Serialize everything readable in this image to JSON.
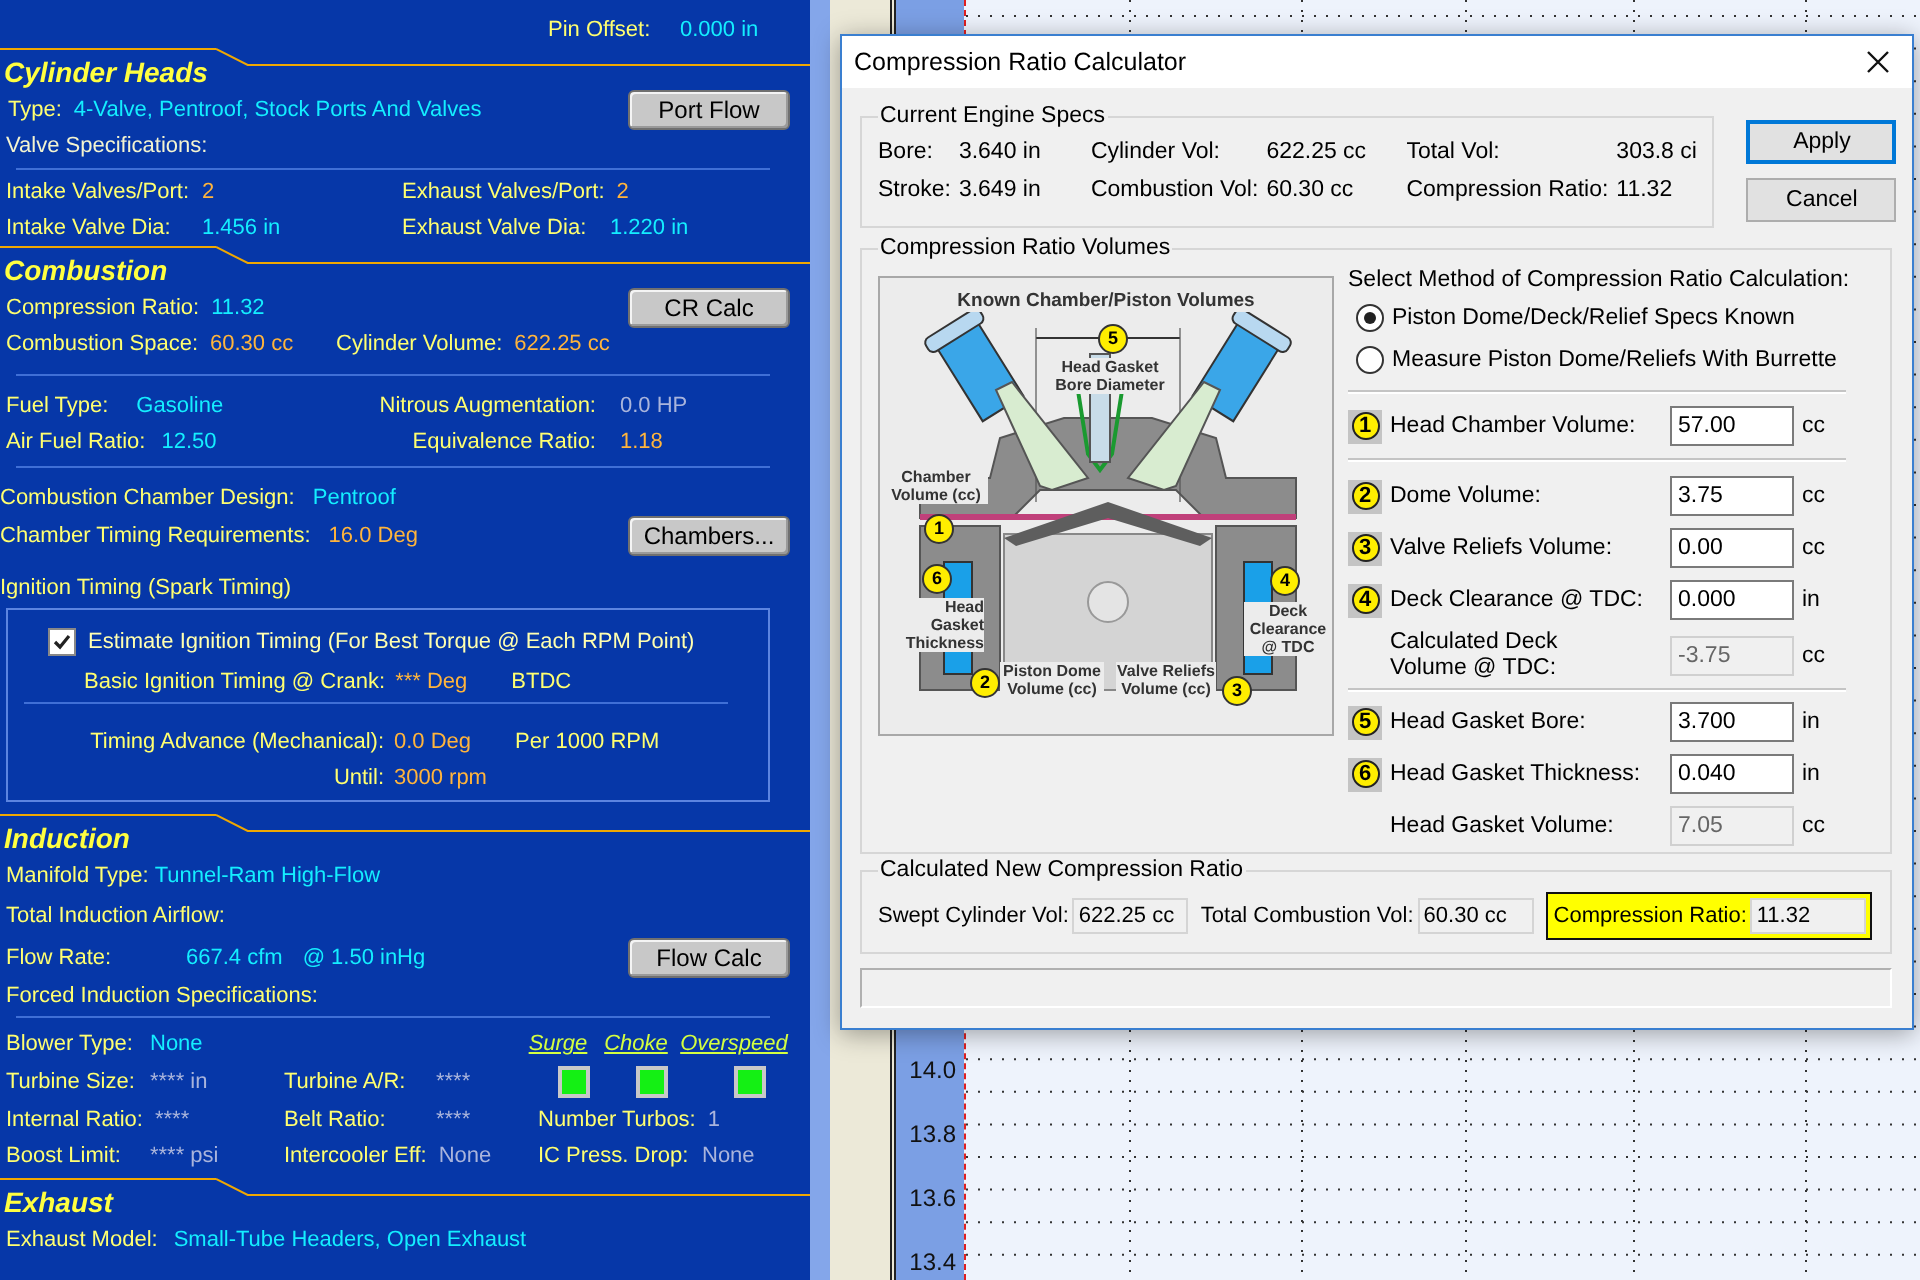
{
  "left_panel": {
    "pin_offset": {
      "label": "Pin Offset:",
      "value": "0.000 in",
      "color": "#14eeff"
    },
    "cylinder_heads": {
      "title": "Cylinder Heads",
      "type": {
        "label": "Type:",
        "value": "4-Valve, Pentroof, Stock Ports And Valves",
        "color": "#14eeff"
      },
      "button": "Port Flow",
      "valve_specs": "Valve Specifications:",
      "fields": [
        {
          "label": "Intake Valves/Port:",
          "value": "2",
          "color": "#ffb43c"
        },
        {
          "label": "Exhaust Valves/Port:",
          "value": "2",
          "color": "#ffb43c"
        },
        {
          "label": "Intake Valve Dia:",
          "value": "1.456 in",
          "color": "#14eeff"
        },
        {
          "label": "Exhaust Valve Dia:",
          "value": "1.220 in",
          "color": "#14eeff"
        }
      ]
    },
    "combustion": {
      "title": "Combustion",
      "compression_ratio": {
        "label": "Compression Ratio:",
        "value": "11.32",
        "color": "#14eeff"
      },
      "button": "CR Calc",
      "volumes": [
        {
          "label": "Combustion Space:",
          "value": "60.30 cc",
          "color": "#ffb43c"
        },
        {
          "label": "Cylinder Volume:",
          "value": "622.25 cc",
          "color": "#ffb43c"
        }
      ],
      "fuel": [
        {
          "label": "Fuel Type:",
          "value": "Gasoline",
          "color": "#14eeff"
        },
        {
          "label": "Nitrous Augmentation:",
          "value": "0.0 HP",
          "color": "#a9b4dc"
        },
        {
          "label": "Air Fuel Ratio:",
          "value": "12.50",
          "color": "#14eeff"
        },
        {
          "label": "Equivalence Ratio:",
          "value": "1.18",
          "color": "#ffb43c"
        }
      ],
      "chamber_design": {
        "label": "Combustion Chamber Design:",
        "value": "Pentroof",
        "color": "#14eeff"
      },
      "timing_requirements": {
        "label": "Chamber Timing Requirements:",
        "value": "16.0 Deg",
        "color": "#ffb43c"
      },
      "chambers_button": "Chambers...",
      "ignition_title": "Ignition Timing (Spark Timing)",
      "ignition": {
        "estimate": {
          "label": "Estimate Ignition Timing (For Best Torque @ Each RPM Point)",
          "checked": true
        },
        "basic": {
          "label": "Basic Ignition Timing @ Crank:",
          "value": "*** Deg",
          "color": "#ffb43c",
          "unit": "BTDC"
        },
        "advance": {
          "label": "Timing Advance (Mechanical):",
          "value": "0.0 Deg",
          "color": "#ffb43c",
          "unit": "Per 1000 RPM"
        },
        "until": {
          "label": "Until:",
          "value": "3000 rpm",
          "color": "#ffb43c"
        }
      }
    },
    "induction": {
      "title": "Induction",
      "manifold": {
        "label": "Manifold Type:",
        "value": "Tunnel-Ram High-Flow",
        "color": "#14eeff"
      },
      "airflow_title": "Total Induction Airflow:",
      "flow_rate": {
        "label": "Flow Rate:",
        "value": "667.4 cfm",
        "at": "@ 1.50 inHg",
        "color": "#14eeff"
      },
      "button": "Flow Calc",
      "forced_title": "Forced Induction Specifications:",
      "blower": {
        "label": "Blower Type:",
        "value": "None",
        "color": "#14eeff"
      },
      "indicators": [
        {
          "label": "Surge",
          "lit": true
        },
        {
          "label": "Choke",
          "lit": true
        },
        {
          "label": "Overspeed",
          "lit": true
        }
      ],
      "turbo_rows": [
        [
          {
            "label": "Turbine Size:",
            "value": "**** in",
            "color": "#a9b4dc"
          },
          {
            "label": "Turbine A/R:",
            "value": "****",
            "color": "#a9b4dc"
          }
        ],
        [
          {
            "label": "Internal Ratio:",
            "value": "****",
            "color": "#a9b4dc"
          },
          {
            "label": "Belt Ratio:",
            "value": "****",
            "color": "#a9b4dc"
          },
          {
            "label": "Number Turbos:",
            "value": "1",
            "color": "#a9b4dc"
          }
        ],
        [
          {
            "label": "Boost Limit:",
            "value": "**** psi",
            "color": "#a9b4dc"
          },
          {
            "label": "Intercooler Eff:",
            "value": "None",
            "color": "#a9b4dc"
          },
          {
            "label": "IC Press. Drop:",
            "value": "None",
            "color": "#a9b4dc"
          }
        ]
      ]
    },
    "exhaust": {
      "title": "Exhaust",
      "model": {
        "label": "Exhaust Model:",
        "value": "Small-Tube Headers, Open Exhaust",
        "color": "#14eeff"
      }
    }
  },
  "chart_axis": {
    "ticks": [
      "14.0",
      "13.8",
      "13.6",
      "13.4"
    ]
  },
  "dialog": {
    "title": "Compression Ratio Calculator",
    "current_specs": {
      "title": "Current Engine Specs",
      "fields": [
        {
          "label": "Bore:",
          "value": "3.640 in"
        },
        {
          "label": "Cylinder Vol:",
          "value": "622.25 cc"
        },
        {
          "label": "Total Vol:",
          "value": "303.8 ci"
        },
        {
          "label": "Stroke:",
          "value": "3.649 in"
        },
        {
          "label": "Combustion Vol:",
          "value": "60.30 cc"
        },
        {
          "label": "Compression Ratio:",
          "value": "11.32"
        }
      ]
    },
    "buttons": [
      {
        "label": "Apply",
        "default": true
      },
      {
        "label": "Cancel",
        "default": false
      }
    ],
    "volumes": {
      "title": "Compression Ratio Volumes",
      "diagram": {
        "title": "Known Chamber/Piston Volumes",
        "labels": [
          "Head Gasket Bore Diameter",
          "Chamber Volume (cc)",
          "Head Gasket Thickness",
          "Piston Dome Volume (cc)",
          "Valve Reliefs Volume (cc)",
          "Deck Clearance @ TDC"
        ],
        "badges": [
          "5",
          "1",
          "6",
          "4",
          "2",
          "3"
        ]
      },
      "method": {
        "title": "Select Method of Compression Ratio Calculation:",
        "options": [
          {
            "label": "Piston Dome/Deck/Relief Specs Known",
            "selected": true
          },
          {
            "label": "Measure Piston Dome/Reliefs With Burrette",
            "selected": false
          }
        ]
      },
      "groups": [
        {
          "rows": [
            {
              "kind": "input",
              "number": "1",
              "label": "Head Chamber Volume:",
              "value": "57.00",
              "unit": "cc"
            }
          ]
        },
        {
          "rows": [
            {
              "kind": "input",
              "number": "2",
              "label": "Dome Volume:",
              "value": "3.75",
              "unit": "cc"
            },
            {
              "kind": "input",
              "number": "3",
              "label": "Valve Reliefs Volume:",
              "value": "0.00",
              "unit": "cc"
            },
            {
              "kind": "input",
              "number": "4",
              "label": "Deck Clearance @ TDC:",
              "value": "0.000",
              "unit": "in"
            },
            {
              "kind": "readonly",
              "label": "Calculated Deck Volume @ TDC:",
              "value": "-3.75",
              "unit": "cc"
            }
          ]
        },
        {
          "rows": [
            {
              "kind": "input",
              "number": "5",
              "label": "Head Gasket Bore:",
              "value": "3.700",
              "unit": "in"
            },
            {
              "kind": "input",
              "number": "6",
              "label": "Head Gasket Thickness:",
              "value": "0.040",
              "unit": "in"
            },
            {
              "kind": "readonly",
              "label": "Head Gasket Volume:",
              "value": "7.05",
              "unit": "cc"
            }
          ]
        }
      ]
    },
    "result": {
      "title": "Calculated New Compression Ratio",
      "fields": [
        {
          "label": "Swept Cylinder Vol:",
          "value": "622.25 cc",
          "highlighted": false
        },
        {
          "label": "Total Combustion Vol:",
          "value": "60.30 cc",
          "highlighted": false
        },
        {
          "label": "Compression Ratio:",
          "value": "11.32",
          "highlighted": true
        }
      ]
    }
  }
}
